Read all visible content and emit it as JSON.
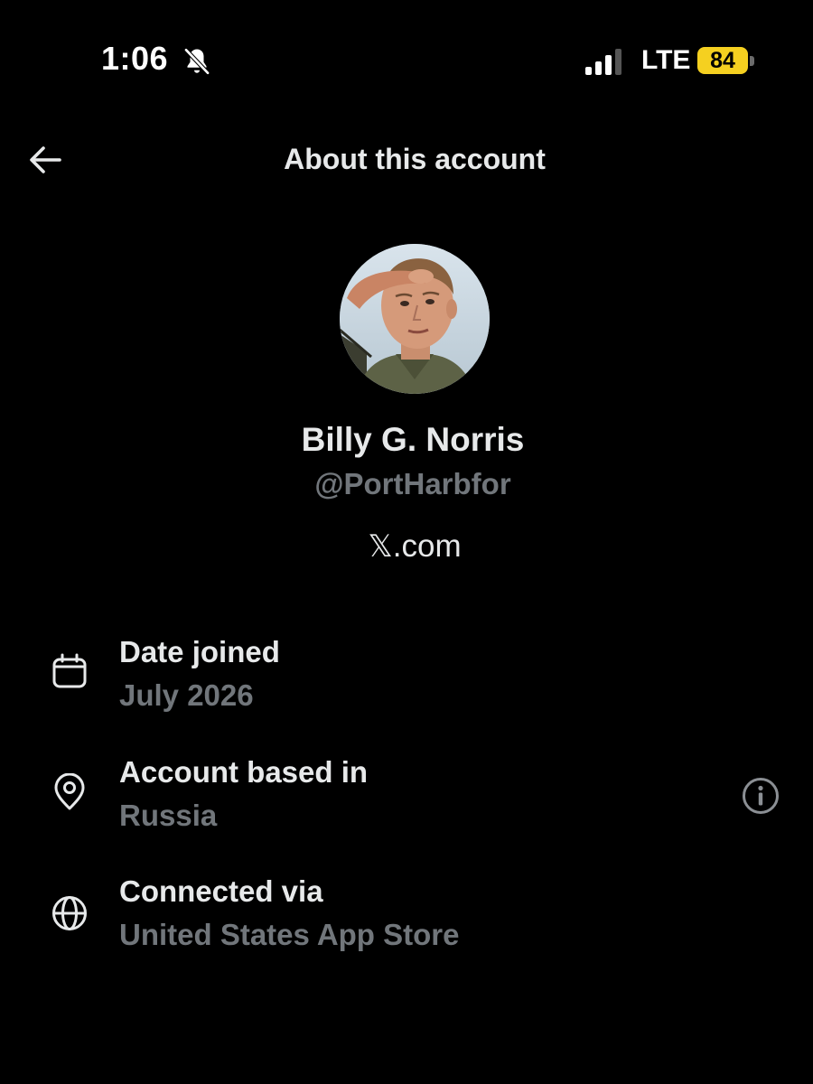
{
  "status_bar": {
    "time": "1:06",
    "network": "LTE",
    "battery": "84",
    "icons": [
      "bell-slash-icon",
      "signal-icon"
    ],
    "battery_color": "#f5d020"
  },
  "header": {
    "back_icon": "arrow-left-icon",
    "title": "About this account"
  },
  "profile": {
    "avatar": "profile-photo",
    "name": "Billy G. Norris",
    "handle": "@PortHarbfor",
    "site_logo": "𝕏",
    "site_suffix": ".com"
  },
  "details": [
    {
      "icon": "calendar-icon",
      "label": "Date joined",
      "value": "July 2026"
    },
    {
      "icon": "location-pin-icon",
      "label": "Account based in",
      "value": "Russia",
      "action_icon": "info-icon"
    },
    {
      "icon": "globe-icon",
      "label": "Connected via",
      "value": "United States App Store"
    }
  ],
  "colors": {
    "background": "#000000",
    "primary_text": "#e7e9ea",
    "secondary_text": "#71767b"
  }
}
